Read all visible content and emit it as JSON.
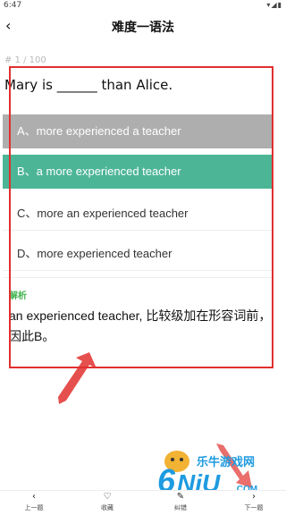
{
  "status_bar": {
    "time": "6:47",
    "icons": "▾◢▮"
  },
  "header": {
    "title": "难度一语法",
    "back_icon": "‹"
  },
  "progress": "# 1 / 100",
  "question": "Mary is ______ than Alice.",
  "options": [
    {
      "label": "A、more experienced a teacher",
      "state": "wrong"
    },
    {
      "label": "B、a more experienced teacher",
      "state": "correct"
    },
    {
      "label": "C、more an experienced teacher",
      "state": "normal"
    },
    {
      "label": "D、more experienced teacher",
      "state": "normal"
    }
  ],
  "analysis": {
    "label": "解析",
    "text": "an experienced teacher, 比较级加在形容词前，因此B。"
  },
  "watermark": {
    "logo": "6NiU.COM",
    "text": "乐牛游戏网"
  },
  "bottom_nav": [
    {
      "icon": "‹",
      "label": "上一题"
    },
    {
      "icon": "♡",
      "label": "收藏"
    },
    {
      "icon": "✎",
      "label": "纠错"
    },
    {
      "icon": "›",
      "label": "下一题"
    }
  ],
  "colors": {
    "correct": "#4cb596",
    "wrong": "#aeaeae",
    "annotation": "#e0302e",
    "analysis_label": "#3fb24f"
  }
}
